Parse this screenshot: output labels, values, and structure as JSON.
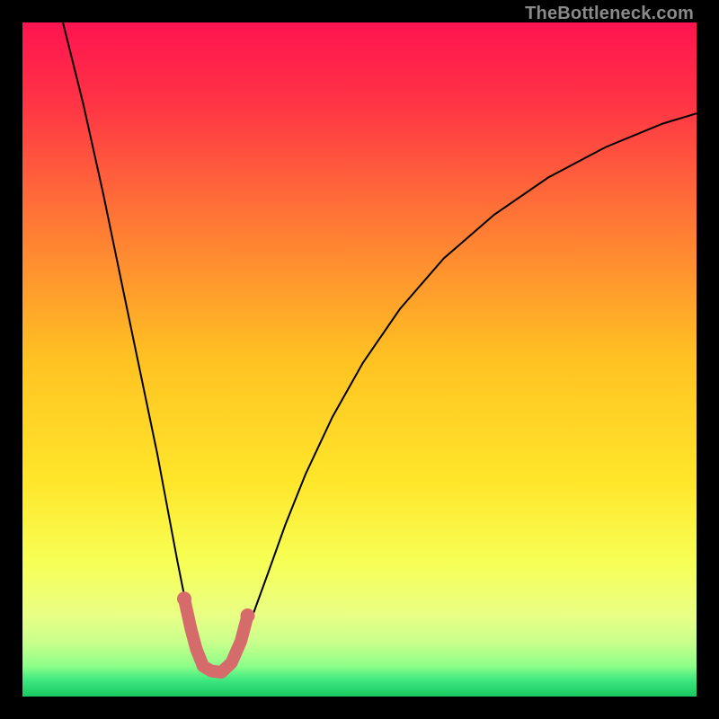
{
  "watermark": "TheBottleneck.com",
  "chart_data": {
    "type": "line",
    "title": "",
    "xlabel": "",
    "ylabel": "",
    "xlim_fraction": [
      0,
      1
    ],
    "ylim_fraction_from_top": [
      0,
      1
    ],
    "gradient_stops": [
      {
        "offset": 0.0,
        "color": "#ff1450"
      },
      {
        "offset": 0.12,
        "color": "#ff3445"
      },
      {
        "offset": 0.3,
        "color": "#ff7a35"
      },
      {
        "offset": 0.5,
        "color": "#ffc222"
      },
      {
        "offset": 0.68,
        "color": "#ffe62a"
      },
      {
        "offset": 0.8,
        "color": "#f7ff55"
      },
      {
        "offset": 0.88,
        "color": "#e9ff85"
      },
      {
        "offset": 0.92,
        "color": "#c8ff8c"
      },
      {
        "offset": 0.955,
        "color": "#8cff88"
      },
      {
        "offset": 0.975,
        "color": "#40e880"
      },
      {
        "offset": 1.0,
        "color": "#18c860"
      }
    ],
    "series": [
      {
        "name": "v-curve",
        "stroke": "#000000",
        "stroke_width": 2,
        "points_fraction": [
          [
            0.06,
            0.0
          ],
          [
            0.09,
            0.12
          ],
          [
            0.12,
            0.255
          ],
          [
            0.15,
            0.4
          ],
          [
            0.175,
            0.52
          ],
          [
            0.2,
            0.64
          ],
          [
            0.215,
            0.72
          ],
          [
            0.23,
            0.8
          ],
          [
            0.242,
            0.86
          ],
          [
            0.252,
            0.905
          ],
          [
            0.262,
            0.935
          ],
          [
            0.278,
            0.962
          ],
          [
            0.298,
            0.965
          ],
          [
            0.316,
            0.945
          ],
          [
            0.33,
            0.91
          ],
          [
            0.345,
            0.87
          ],
          [
            0.365,
            0.815
          ],
          [
            0.39,
            0.745
          ],
          [
            0.42,
            0.67
          ],
          [
            0.46,
            0.585
          ],
          [
            0.505,
            0.505
          ],
          [
            0.56,
            0.425
          ],
          [
            0.625,
            0.35
          ],
          [
            0.7,
            0.285
          ],
          [
            0.78,
            0.23
          ],
          [
            0.865,
            0.185
          ],
          [
            0.95,
            0.15
          ],
          [
            1.0,
            0.135
          ]
        ]
      },
      {
        "name": "marker-bridge",
        "stroke": "#d66b6b",
        "stroke_width": 14,
        "linecap": "round",
        "points_fraction": [
          [
            0.24,
            0.855
          ],
          [
            0.25,
            0.9
          ],
          [
            0.258,
            0.93
          ],
          [
            0.268,
            0.955
          ],
          [
            0.28,
            0.962
          ],
          [
            0.295,
            0.964
          ],
          [
            0.31,
            0.95
          ],
          [
            0.324,
            0.918
          ],
          [
            0.334,
            0.88
          ]
        ]
      }
    ],
    "marker_dots": {
      "fill": "#d66b6b",
      "radius": 8,
      "points_fraction": [
        [
          0.24,
          0.855
        ],
        [
          0.334,
          0.88
        ]
      ]
    }
  }
}
